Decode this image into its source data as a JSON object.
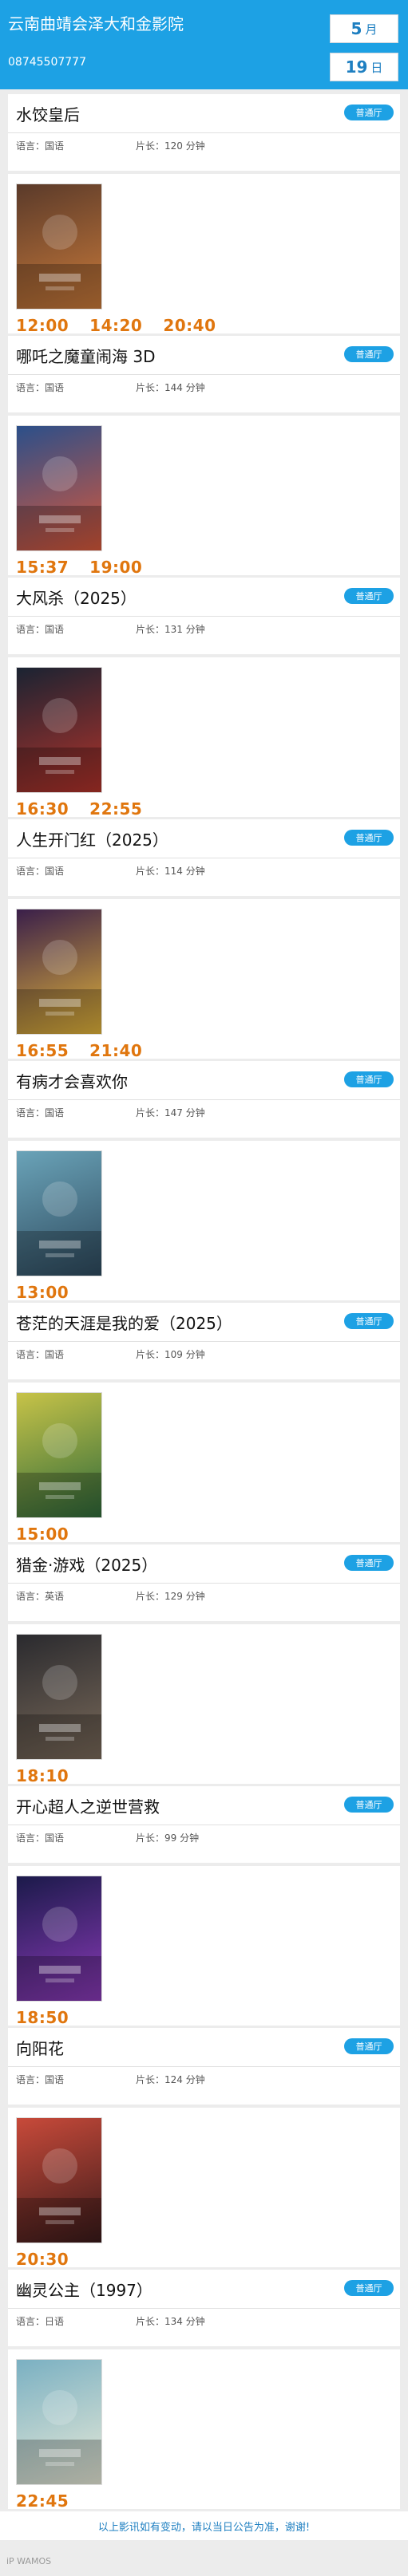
{
  "header": {
    "cinema_name": "云南曲靖会泽大和金影院",
    "phone": "08745507777",
    "month_num": "5",
    "month_unit": "月",
    "day_num": "19",
    "day_unit": "日"
  },
  "labels": {
    "language_prefix": "语言：",
    "duration_prefix": "片长：",
    "duration_unit": "分钟"
  },
  "films": [
    {
      "title": "水饺皇后",
      "hall": "普通厅",
      "language": "国语",
      "duration": "120",
      "times": [
        "12:00",
        "14:20",
        "20:40"
      ],
      "poster_colors": [
        "#5a3a2a",
        "#c97a3a"
      ],
      "poster_icon": "poster-image"
    },
    {
      "title": "哪吒之魔童闹海 3D",
      "hall": "普通厅",
      "language": "国语",
      "duration": "144",
      "times": [
        "15:37",
        "19:00"
      ],
      "poster_colors": [
        "#2b4f8a",
        "#d8583a"
      ],
      "poster_icon": "poster-image"
    },
    {
      "title": "大风杀（2025）",
      "hall": "普通厅",
      "language": "国语",
      "duration": "131",
      "times": [
        "16:30",
        "22:55"
      ],
      "poster_colors": [
        "#1a2332",
        "#b3332a"
      ],
      "poster_icon": "poster-image"
    },
    {
      "title": "人生开门红（2025）",
      "hall": "普通厅",
      "language": "国语",
      "duration": "114",
      "times": [
        "16:55",
        "21:40"
      ],
      "poster_colors": [
        "#3a1f4a",
        "#e2b43a"
      ],
      "poster_icon": "poster-image"
    },
    {
      "title": "有病才会喜欢你",
      "hall": "普通厅",
      "language": "国语",
      "duration": "147",
      "times": [
        "13:00"
      ],
      "poster_colors": [
        "#6aa3b8",
        "#2e4a5e"
      ],
      "poster_icon": "poster-image"
    },
    {
      "title": "苍茫的天涯是我的爱（2025）",
      "hall": "普通厅",
      "language": "国语",
      "duration": "109",
      "times": [
        "15:00"
      ],
      "poster_colors": [
        "#c7c348",
        "#2f6a3a"
      ],
      "poster_icon": "poster-image"
    },
    {
      "title": "猎金·游戏（2025）",
      "hall": "普通厅",
      "language": "英语",
      "duration": "129",
      "times": [
        "18:10"
      ],
      "poster_colors": [
        "#2a2a2e",
        "#7a6a5a"
      ],
      "poster_icon": "poster-image"
    },
    {
      "title": "开心超人之逆世营救",
      "hall": "普通厅",
      "language": "国语",
      "duration": "99",
      "times": [
        "18:50"
      ],
      "poster_colors": [
        "#1b1a4a",
        "#8a3ab8"
      ],
      "poster_icon": "poster-image"
    },
    {
      "title": "向阳花",
      "hall": "普通厅",
      "language": "国语",
      "duration": "124",
      "times": [
        "20:30"
      ],
      "poster_colors": [
        "#c84a3a",
        "#3a1a1a"
      ],
      "poster_icon": "poster-image"
    },
    {
      "title": "幽灵公主（1997）",
      "hall": "普通厅",
      "language": "日语",
      "duration": "134",
      "times": [
        "22:45"
      ],
      "poster_colors": [
        "#7ab0c2",
        "#e8ead8"
      ],
      "poster_icon": "poster-image"
    }
  ],
  "footer": {
    "notice": "以上影讯如有变动，请以当日公告为准，谢谢!",
    "watermark": "iP WAMOS"
  },
  "colors": {
    "header_bg": "#1da1e4",
    "accent_blue": "#1e7fc1",
    "time_orange": "#e0760e",
    "page_bg": "#ececec"
  }
}
